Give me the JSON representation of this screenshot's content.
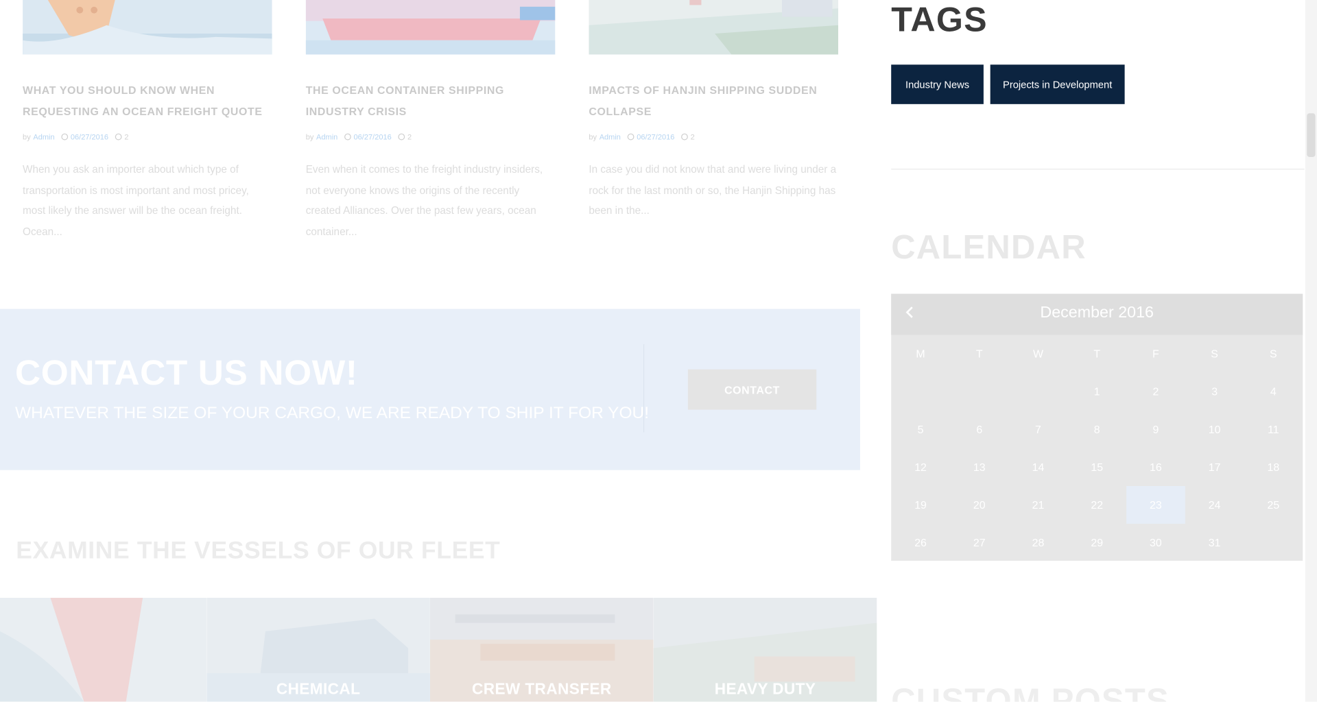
{
  "posts": [
    {
      "title": "WHAT YOU SHOULD KNOW WHEN REQUESTING AN OCEAN FREIGHT QUOTE",
      "by": "by",
      "author": "Admin",
      "date": "06/27/2016",
      "comments": "2",
      "excerpt": "When you ask an importer about which type of transportation is most important and most pricey, most likely the answer will be the ocean freight. Ocean..."
    },
    {
      "title": "THE OCEAN CONTAINER SHIPPING INDUSTRY CRISIS",
      "by": "by",
      "author": "Admin",
      "date": "06/27/2016",
      "comments": "2",
      "excerpt": "Even when it comes to the freight industry insiders, not everyone knows the origins of the recently created Alliances. Over the past few years, ocean container..."
    },
    {
      "title": "IMPACTS OF HANJIN SHIPPING SUDDEN COLLAPSE",
      "by": "by",
      "author": "Admin",
      "date": "06/27/2016",
      "comments": "2",
      "excerpt": "In case you did not know that and were living under a rock for the last month or so, the Hanjin Shipping has been in the..."
    }
  ],
  "contact": {
    "heading": "CONTACT US NOW!",
    "subheading": "WHATEVER THE SIZE OF YOUR CARGO, WE ARE READY TO SHIP IT FOR YOU!",
    "button": "CONTACT"
  },
  "fleet": {
    "heading": "EXAMINE THE VESSELS OF OUR FLEET",
    "tiles": [
      "",
      "CHEMICAL",
      "CREW TRANSFER",
      "HEAVY DUTY"
    ]
  },
  "sidebar": {
    "tags_title": "TAGS",
    "tags": [
      "Industry News",
      "Projects in Development"
    ],
    "calendar_title": "CALENDAR",
    "custom_posts_title": "CUSTOM POSTS"
  },
  "calendar": {
    "month": "December 2016",
    "weekdays": [
      "M",
      "T",
      "W",
      "T",
      "F",
      "S",
      "S"
    ],
    "first_weekday_index": 3,
    "days_in_month": 31,
    "today": 23
  },
  "colors": {
    "tag_bg": "#0c2440",
    "contact_band": "#e8eff9",
    "calendar_today": "#e6edf7"
  }
}
